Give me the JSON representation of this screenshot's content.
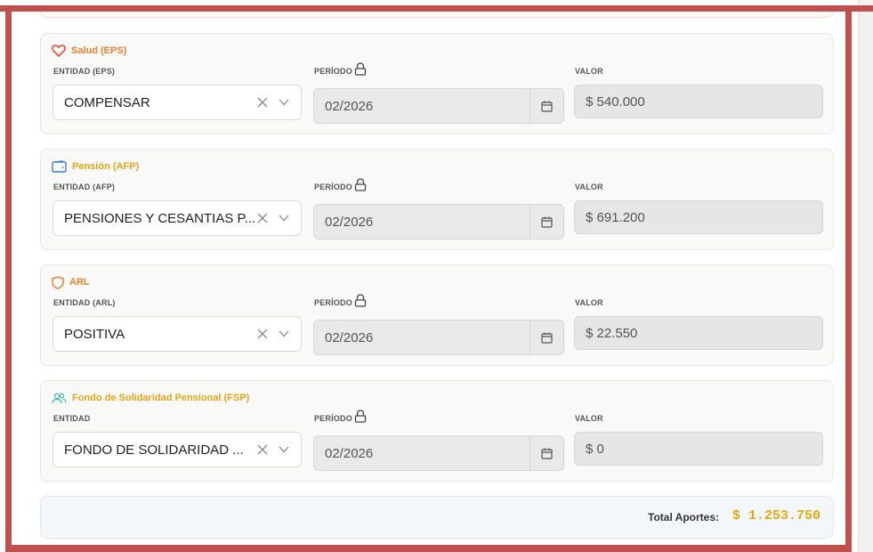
{
  "sections": [
    {
      "title": "Salud (EPS)",
      "title_color": "#e5822f",
      "icon": "heart-icon",
      "entity_label": "ENTIDAD (EPS)",
      "period_label": "PERÍODO",
      "value_label": "VALOR",
      "entity": "COMPENSAR",
      "period": "02/2026",
      "value": "$ 540.000"
    },
    {
      "title": "Pensión (AFP)",
      "title_color": "#e5a41a",
      "icon": "wallet-icon",
      "entity_label": "ENTIDAD (AFP)",
      "period_label": "PERÍODO",
      "value_label": "VALOR",
      "entity": "PENSIONES Y CESANTIAS P...",
      "period": "02/2026",
      "value": "$ 691.200"
    },
    {
      "title": "ARL",
      "title_color": "#e5822f",
      "icon": "shield-icon",
      "entity_label": "ENTIDAD (ARL)",
      "period_label": "PERÍODO",
      "value_label": "VALOR",
      "entity": "POSITIVA",
      "period": "02/2026",
      "value": "$ 22.550"
    },
    {
      "title": "Fondo de Solidaridad Pensional (FSP)",
      "title_color": "#e5a41a",
      "icon": "users-icon",
      "entity_label": "ENTIDAD",
      "period_label": "PERÍODO",
      "value_label": "VALOR",
      "entity": "FONDO DE SOLIDARIDAD ...",
      "period": "02/2026",
      "value": "$ 0"
    }
  ],
  "total": {
    "label": "Total Aportes:",
    "value": "$ 1.253.750"
  },
  "colors": {
    "frame_border": "#c0504d",
    "total_value": "#e8a70e",
    "heart_icon": "#e8533c",
    "wallet_icon": "#3b7ddd",
    "shield_icon": "#e8803c",
    "users_icon": "#3bb9a8"
  }
}
